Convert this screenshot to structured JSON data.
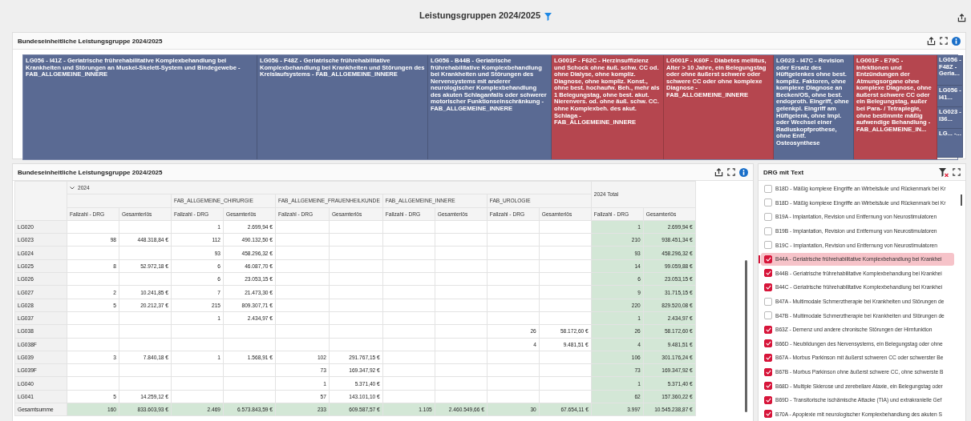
{
  "page": {
    "title": "Leistungsgruppen 2024/2025"
  },
  "treemap_panel": {
    "title": "Bundeseinheitliche Leistungsgruppe 2024/2025",
    "tiles": [
      {
        "label": "LG056 - I41Z - Geriatrische frührehabilitative Komplexbehandlung bei Krankheiten und Störungen an Muskel-Skelett-System und Bindegewebe - FAB_ALLGEMEINE_INNERE",
        "color": "#5a6a93"
      },
      {
        "label": "LG056 - F48Z - Geriatrische frührehabilitative Komplexbehandlung bei Krankheiten und Störungen des Kreislaufsystems - FAB_ALLGEMEINE_INNERE",
        "color": "#5a6a93"
      },
      {
        "label": "LG056 - B44B - Geriatrische frührehabilitative Komplexbehandlung bei Krankheiten und Störungen des Nervensystems mit anderer neurologischer Komplexbehandlung des akuten Schlaganfalls oder schwerer motorischer Funktionseinschränkung - FAB_ALLGEMEINE_INNERE",
        "color": "#5a6a93"
      },
      {
        "label": "LG001F - F62C - Herzinsuffizienz und Schock ohne äuß. schw. CC od. ohne Dialyse, ohne kompliz. Diagnose, ohne kompliz. Konst., ohne best. hochaufw. Beh., mehr als 1 Belegungstag, ohne best. akut. Nierenvers. od. ohne äuß. schw. CC. ohne Komplexbeh. des akut. Schlaga - FAB_ALLGEMEINE_INNERE",
        "color": "#b5464f"
      },
      {
        "label": "LG001F - K60F - Diabetes mellitus, Alter > 10 Jahre, ein Belegungstag oder ohne äußerst schwere oder schwere CC oder ohne komplexe Diagnose - FAB_ALLGEMEINE_INNERE",
        "color": "#b5464f"
      },
      {
        "label": "LG023 - I47C - Revision oder Ersatz des Hüftgelenkes ohne best. kompliz. Faktoren, ohne komplexe Diagnose an Becken/OS, ohne best. endoproth. Eingriff, ohne gelenkpl. Eingriff am Hüftgelenk, ohne Impl. oder Wechsel einer Radiuskopfprothese, ohne Entf. Osteosynthese",
        "color": "#5a6a93"
      },
      {
        "label": "LG001F - E79C - Infektionen und Entzündungen der Atmungsorgane ohne komplexe Diagnose, ohne äußerst schwere CC oder ein Belegungstag, außer bei Para- / Tetraplegie, ohne bestimmte mäßig aufwendige Behandlung - FAB_ALLGEMEINE_IN...",
        "color": "#b5464f"
      },
      {
        "label": "LG056 - F48Z - Geria...",
        "color": "#5a6a93"
      },
      {
        "label": "LG056 - I41...",
        "color": "#5a6a93"
      },
      {
        "label": "LG023 - I36...",
        "color": "#5a6a93"
      },
      {
        "label": "LG... -...",
        "color": "#5a6a93"
      }
    ]
  },
  "table_panel": {
    "title": "Bundeseinheitliche Leistungsgruppe 2024/2025",
    "year_label": "2024",
    "expanded": true,
    "total_label": "2024 Total",
    "groups": [
      {
        "kind": "unnamed"
      },
      {
        "kind": "named",
        "label": "FAB_ALLGEMEINE_CHIRURGIE"
      },
      {
        "kind": "named",
        "label": "FAB_ALLGEMEINE_FRAUENHEILKUNDE"
      },
      {
        "kind": "named",
        "label": "FAB_ALLGEMEINE_INNERE"
      },
      {
        "kind": "named",
        "label": "FAB_UROLOGIE"
      }
    ],
    "measures": [
      "Fallzahl - DRG",
      "Gesamterlös",
      "Fallzahl - DRG",
      "Gesamterlös",
      "Fallzahl - DRG",
      "Gesamterlös",
      "Fallzahl - DRG",
      "Gesamterlös",
      "Fallzahl - DRG",
      "Gesamterlös",
      "Fallzahl - DRG",
      "Gesamterlös"
    ],
    "rows": [
      {
        "kind": "data",
        "label": "LG020",
        "cells": [
          null,
          null,
          "1",
          "2.699,94 €",
          null,
          null,
          null,
          null,
          null,
          null,
          "1",
          "2.699,94 €"
        ]
      },
      {
        "kind": "data",
        "label": "LG023",
        "cells": [
          "98",
          "448.318,84 €",
          "112",
          "490.132,50 €",
          null,
          null,
          null,
          null,
          null,
          null,
          "210",
          "938.451,34 €"
        ]
      },
      {
        "kind": "data",
        "label": "LG024",
        "cells": [
          null,
          null,
          "93",
          "458.296,32 €",
          null,
          null,
          null,
          null,
          null,
          null,
          "93",
          "458.296,32 €"
        ]
      },
      {
        "kind": "data",
        "label": "LG025",
        "cells": [
          "8",
          "52.972,18 €",
          "6",
          "46.087,70 €",
          null,
          null,
          null,
          null,
          null,
          null,
          "14",
          "99.059,88 €"
        ]
      },
      {
        "kind": "data",
        "label": "LG026",
        "cells": [
          null,
          null,
          "6",
          "23.053,15 €",
          null,
          null,
          null,
          null,
          null,
          null,
          "6",
          "23.053,15 €"
        ]
      },
      {
        "kind": "data",
        "label": "LG027",
        "cells": [
          "2",
          "10.241,85 €",
          "7",
          "21.473,30 €",
          null,
          null,
          null,
          null,
          null,
          null,
          "9",
          "31.715,15 €"
        ]
      },
      {
        "kind": "data",
        "label": "LG028",
        "cells": [
          "5",
          "20.212,37 €",
          "215",
          "809.307,71 €",
          null,
          null,
          null,
          null,
          null,
          null,
          "220",
          "829.520,08 €"
        ]
      },
      {
        "kind": "data",
        "label": "LG037",
        "cells": [
          null,
          null,
          "1",
          "2.434,97 €",
          null,
          null,
          null,
          null,
          null,
          null,
          "1",
          "2.434,97 €"
        ]
      },
      {
        "kind": "data",
        "label": "LG038",
        "cells": [
          null,
          null,
          null,
          null,
          null,
          null,
          null,
          null,
          "26",
          "58.172,60 €",
          "26",
          "58.172,60 €"
        ]
      },
      {
        "kind": "data",
        "label": "LG038F",
        "cells": [
          null,
          null,
          null,
          null,
          null,
          null,
          null,
          null,
          "4",
          "9.481,51 €",
          "4",
          "9.481,51 €"
        ]
      },
      {
        "kind": "data",
        "label": "LG039",
        "cells": [
          "3",
          "7.840,18 €",
          "1",
          "1.568,91 €",
          "102",
          "291.767,15 €",
          null,
          null,
          null,
          null,
          "106",
          "301.176,24 €"
        ]
      },
      {
        "kind": "data",
        "label": "LG039F",
        "cells": [
          null,
          null,
          null,
          null,
          "73",
          "169.347,92 €",
          null,
          null,
          null,
          null,
          "73",
          "169.347,92 €"
        ]
      },
      {
        "kind": "data",
        "label": "LG040",
        "cells": [
          null,
          null,
          null,
          null,
          "1",
          "5.371,40 €",
          null,
          null,
          null,
          null,
          "1",
          "5.371,40 €"
        ]
      },
      {
        "kind": "data",
        "label": "LG041",
        "cells": [
          "5",
          "14.259,12 €",
          null,
          null,
          "57",
          "143.101,10 €",
          null,
          null,
          null,
          null,
          "62",
          "157.360,22 €"
        ]
      },
      {
        "kind": "total",
        "label": "Gesamtsumme",
        "cells": [
          "160",
          "833.603,93 €",
          "2.469",
          "6.573.843,59 €",
          "233",
          "609.587,57 €",
          "1.105",
          "2.460.549,66 €",
          "30",
          "67.654,11 €",
          "3.997",
          "10.545.238,87 €"
        ]
      }
    ]
  },
  "drg_panel": {
    "title": "DRG mit Text",
    "items": [
      {
        "label": "B18D - Mäßig komplexe Eingriffe an Wirbelsäule und Rückenmark bei Kr",
        "checked": false,
        "selected": false
      },
      {
        "label": "B18D - Mäßig komplexe Eingriffe an Wirbelsäule und Rückenmark bei Kr",
        "checked": false,
        "selected": false
      },
      {
        "label": "B19A - Implantation, Revision und Entfernung von Neurostimulatoren",
        "checked": false,
        "selected": false
      },
      {
        "label": "B19B - Implantation, Revision und Entfernung von Neurostimulatoren",
        "checked": false,
        "selected": false
      },
      {
        "label": "B19C - Implantation, Revision und Entfernung von Neurostimulatoren",
        "checked": false,
        "selected": false
      },
      {
        "label": "B44A - Geriatrische frührehabilitative Komplexbehandlung bei Krankhei",
        "checked": true,
        "selected": true
      },
      {
        "label": "B44B - Geriatrische frührehabilitative Komplexbehandlung bei Krankhei",
        "checked": true,
        "selected": false
      },
      {
        "label": "B44C - Geriatrische frührehabilitative Komplexbehandlung bei Krankhei",
        "checked": true,
        "selected": false
      },
      {
        "label": "B47A - Multimodale Schmerztherapie bei Krankheiten und Störungen de",
        "checked": false,
        "selected": false
      },
      {
        "label": "B47B - Multimodale Schmerztherapie bei Krankheiten und Störungen de",
        "checked": false,
        "selected": false
      },
      {
        "label": "B63Z - Demenz und andere chronische Störungen der Hirnfunktion",
        "checked": true,
        "selected": false
      },
      {
        "label": "B66D - Neubildungen des Nervensystems, ein Belegungstag oder ohne",
        "checked": true,
        "selected": false
      },
      {
        "label": "B67A - Morbus Parkinson mit äußerst schweren CC oder schwerster Be",
        "checked": true,
        "selected": false
      },
      {
        "label": "B67B - Morbus Parkinson ohne äußerst schwere CC, ohne schwerste B",
        "checked": true,
        "selected": false
      },
      {
        "label": "B68D - Multiple Sklerose und zerebellare Ataxie, ein Belegungstag oder",
        "checked": true,
        "selected": false
      },
      {
        "label": "B69D - Transitorische ischämische Attacke (TIA) und extrakranielle Gef",
        "checked": true,
        "selected": false
      },
      {
        "label": "B70A - Apoplexie mit neurologischer Komplexbehandlung des akuten S",
        "checked": true,
        "selected": false
      }
    ]
  }
}
